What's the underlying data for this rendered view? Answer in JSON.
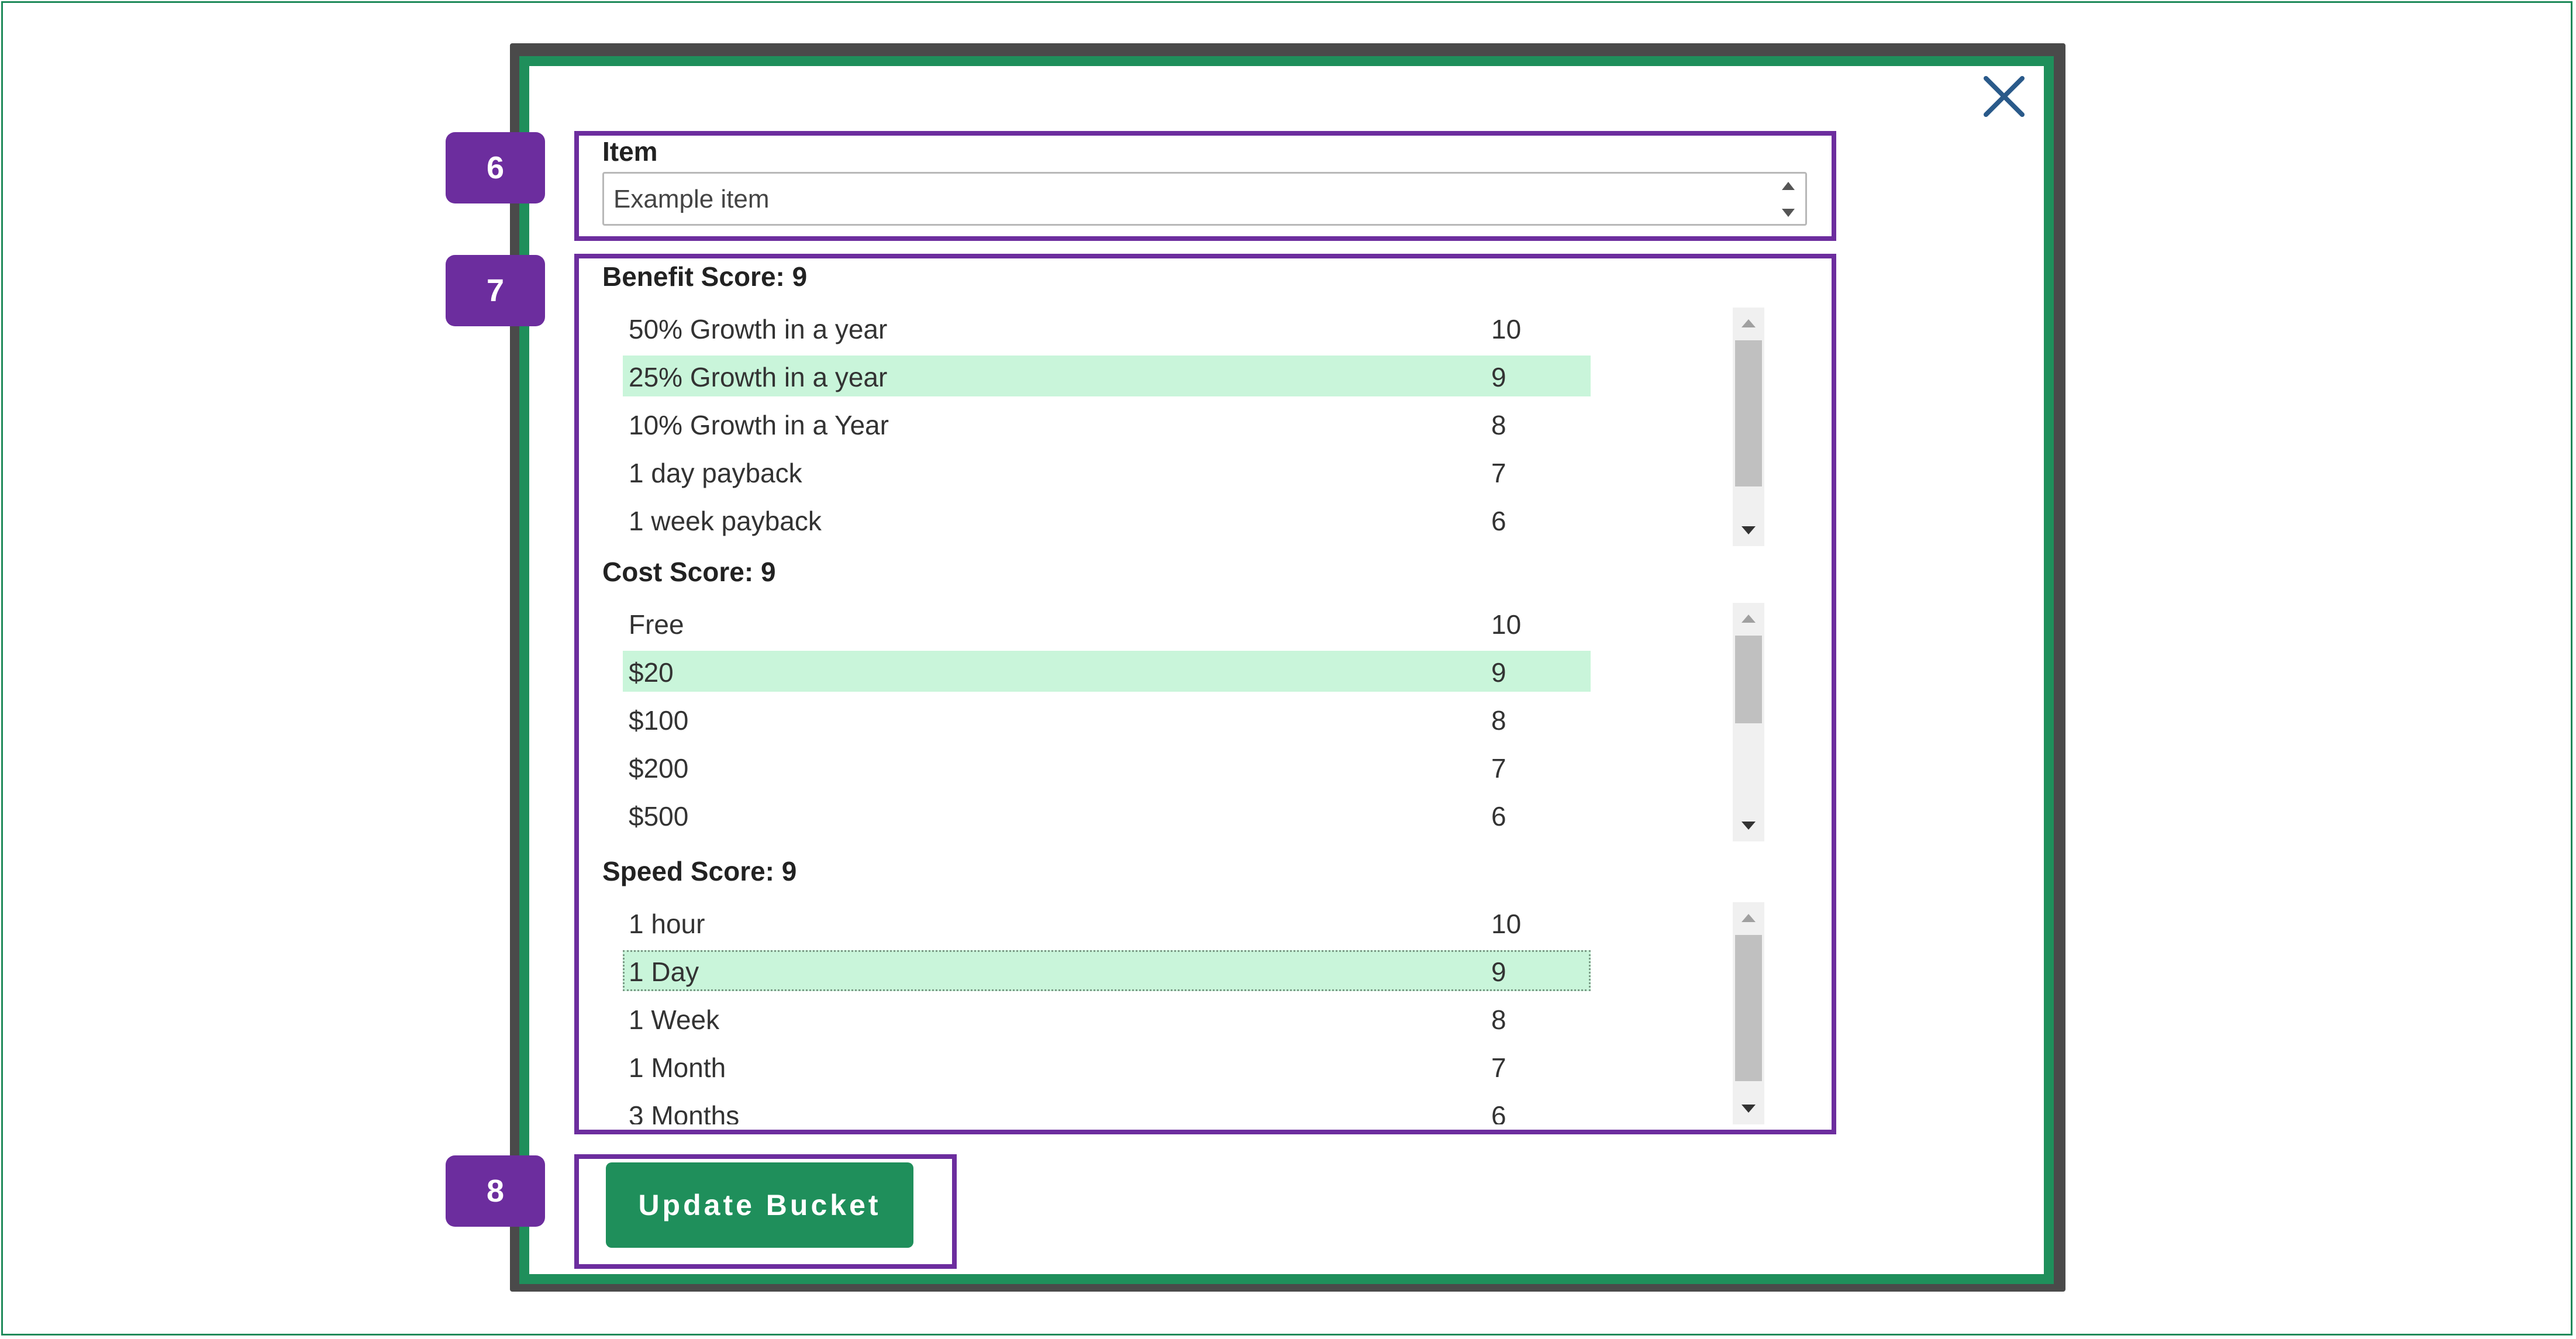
{
  "colors": {
    "accent": "#1f8f5b",
    "callout": "#6c2d9e",
    "selected_row": "#c9f5da",
    "frame": "#1e8a5a"
  },
  "icons": {
    "close": "close-icon"
  },
  "callouts": [
    "6",
    "7",
    "8"
  ],
  "item": {
    "label": "Item",
    "value": "Example item"
  },
  "benefit": {
    "heading": "Benefit Score: 9",
    "rows": [
      {
        "label": "50% Growth in a year",
        "score": "10"
      },
      {
        "label": "25% Growth in a year",
        "score": "9"
      },
      {
        "label": "10% Growth in a Year",
        "score": "8"
      },
      {
        "label": "1 day payback",
        "score": "7"
      },
      {
        "label": "1 week payback",
        "score": "6"
      }
    ]
  },
  "cost": {
    "heading": "Cost Score: 9",
    "rows": [
      {
        "label": "Free",
        "score": "10"
      },
      {
        "label": "$20",
        "score": "9"
      },
      {
        "label": "$100",
        "score": "8"
      },
      {
        "label": "$200",
        "score": "7"
      },
      {
        "label": "$500",
        "score": "6"
      }
    ]
  },
  "speed": {
    "heading": "Speed Score: 9",
    "rows": [
      {
        "label": "1 hour",
        "score": "10"
      },
      {
        "label": "1 Day",
        "score": "9"
      },
      {
        "label": "1 Week",
        "score": "8"
      },
      {
        "label": "1 Month",
        "score": "7"
      },
      {
        "label": "3 Months",
        "score": "6"
      }
    ]
  },
  "actions": {
    "update_label": "Update Bucket"
  }
}
